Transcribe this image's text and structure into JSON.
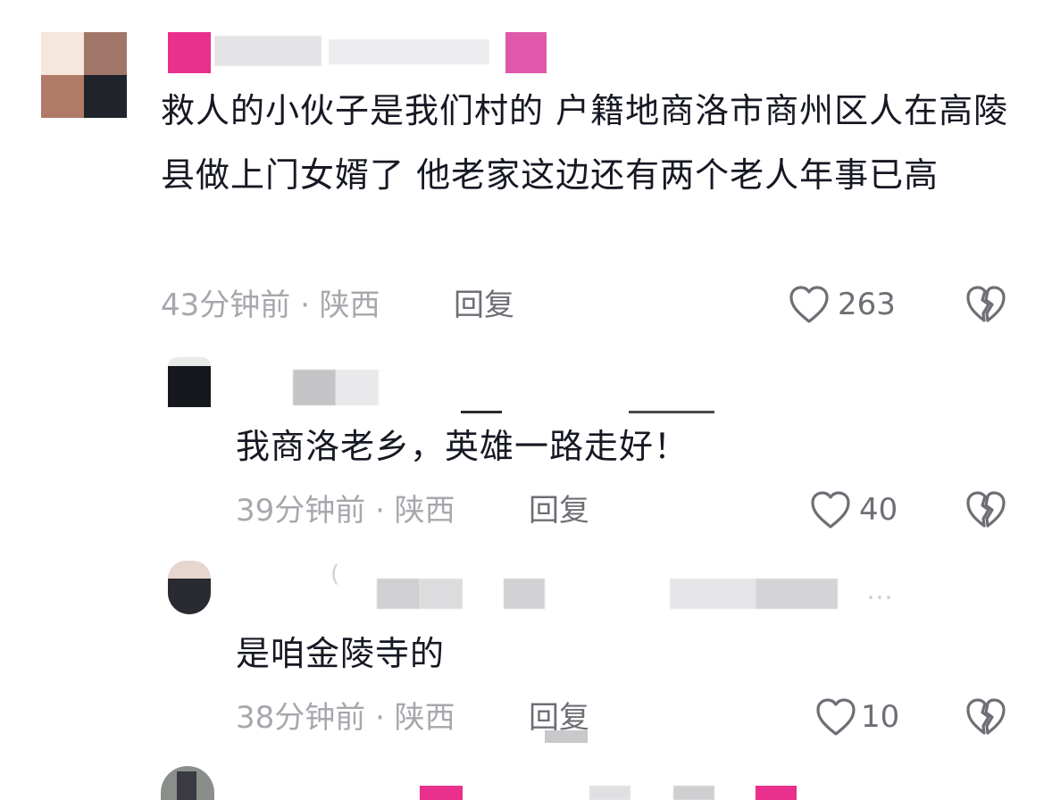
{
  "comments": [
    {
      "text": "救人的小伙子是我们村的 户籍地商洛市商州区人在高陵县做上门女婿了 他老家这边还有两个老人年事已高",
      "meta": "43分钟前 · 陕西",
      "reply": "回复",
      "likes": "263"
    },
    {
      "text": "我商洛老乡，英雄一路走好！",
      "meta": "39分钟前 · 陕西",
      "reply": "回复",
      "likes": "40"
    },
    {
      "text": "是咱金陵寺的",
      "meta": "38分钟前 · 陕西",
      "reply": "回复",
      "likes": "10",
      "partial_text": "…"
    }
  ],
  "colors": {
    "text": "#161823",
    "meta": "#a7a8ad",
    "action": "#6e6f75",
    "brand": "#e8308c"
  },
  "icons": [
    "heart-outline-icon",
    "broken-heart-icon"
  ]
}
